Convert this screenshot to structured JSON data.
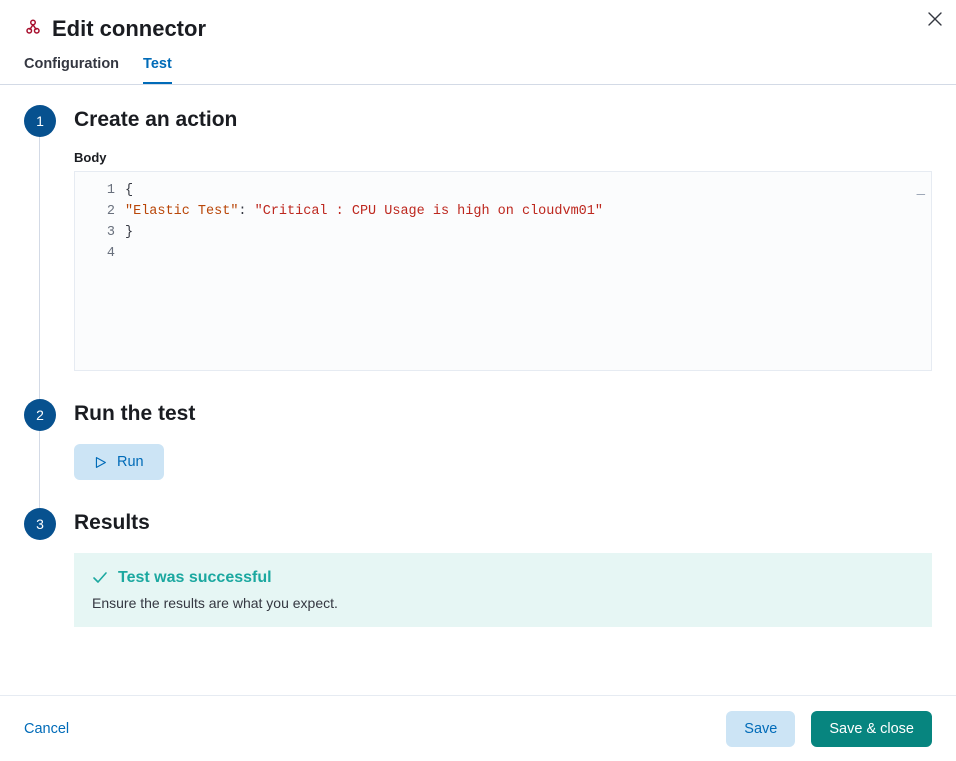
{
  "header": {
    "title": "Edit connector"
  },
  "tabs": {
    "configuration": "Configuration",
    "test": "Test"
  },
  "steps": {
    "step1": {
      "num": "1",
      "title": "Create an action",
      "body_label": "Body",
      "code": {
        "line1_open": "{",
        "line2_key": "\"Elastic Test\"",
        "line2_colon": ": ",
        "line2_val": "\"Critical : CPU Usage is high on cloudvm01\"",
        "line3_close": "}",
        "gutter": [
          "1",
          "2",
          "3",
          "4"
        ]
      }
    },
    "step2": {
      "num": "2",
      "title": "Run the test",
      "run_label": "Run"
    },
    "step3": {
      "num": "3",
      "title": "Results",
      "callout_title": "Test was successful",
      "callout_desc": "Ensure the results are what you expect."
    }
  },
  "footer": {
    "cancel": "Cancel",
    "save": "Save",
    "save_close": "Save & close"
  }
}
